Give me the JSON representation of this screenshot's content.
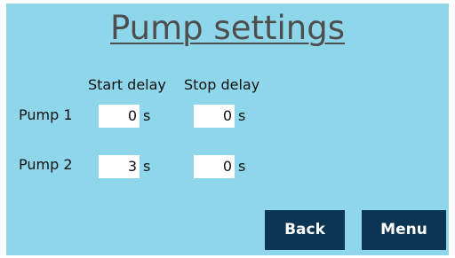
{
  "title": "Pump settings",
  "columns": {
    "start_delay": "Start delay",
    "stop_delay": "Stop delay"
  },
  "unit": "s",
  "pumps": [
    {
      "label": "Pump 1",
      "start_delay": "0",
      "stop_delay": "0"
    },
    {
      "label": "Pump 2",
      "start_delay": "3",
      "stop_delay": "0"
    }
  ],
  "buttons": {
    "back": "Back",
    "menu": "Menu"
  },
  "colors": {
    "background": "#8ed6ea",
    "title": "#4e4e4e",
    "button_bg": "#0b3552",
    "button_text": "#ffffff",
    "field_bg": "#ffffff"
  }
}
